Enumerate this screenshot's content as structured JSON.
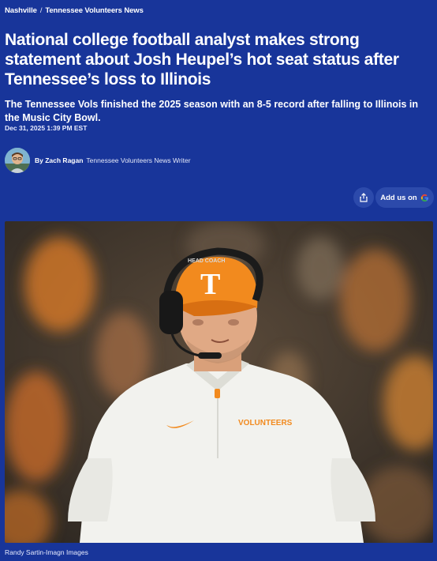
{
  "breadcrumb": {
    "items": [
      "Nashville",
      "Tennessee Volunteers News"
    ],
    "separator": "/"
  },
  "article": {
    "headline": "National college football analyst makes strong statement about Josh Heupel’s hot seat status after Tennessee’s loss to Illinois",
    "dek": "The Tennessee Vols finished the 2025 season with an 8-5 record after falling to Illinois in the Music City Bowl.",
    "timestamp": "Dec 31, 2025 1:39 PM EST",
    "author": {
      "name": "By Zach Ragan",
      "role": "Tennessee Volunteers News Writer"
    }
  },
  "actions": {
    "share_icon": "share-icon",
    "add_us_label": "Add us on",
    "add_us_icon": "google-g-icon"
  },
  "photo": {
    "caption": "Randy Sartin-Imagn Images",
    "cap_logo_text": "T",
    "shirt_text": "VOLUNTEERS",
    "headset_text": "HEAD COACH"
  },
  "colors": {
    "background": "#18359a",
    "accent_orange": "#f28a1e",
    "text": "#ffffff"
  }
}
